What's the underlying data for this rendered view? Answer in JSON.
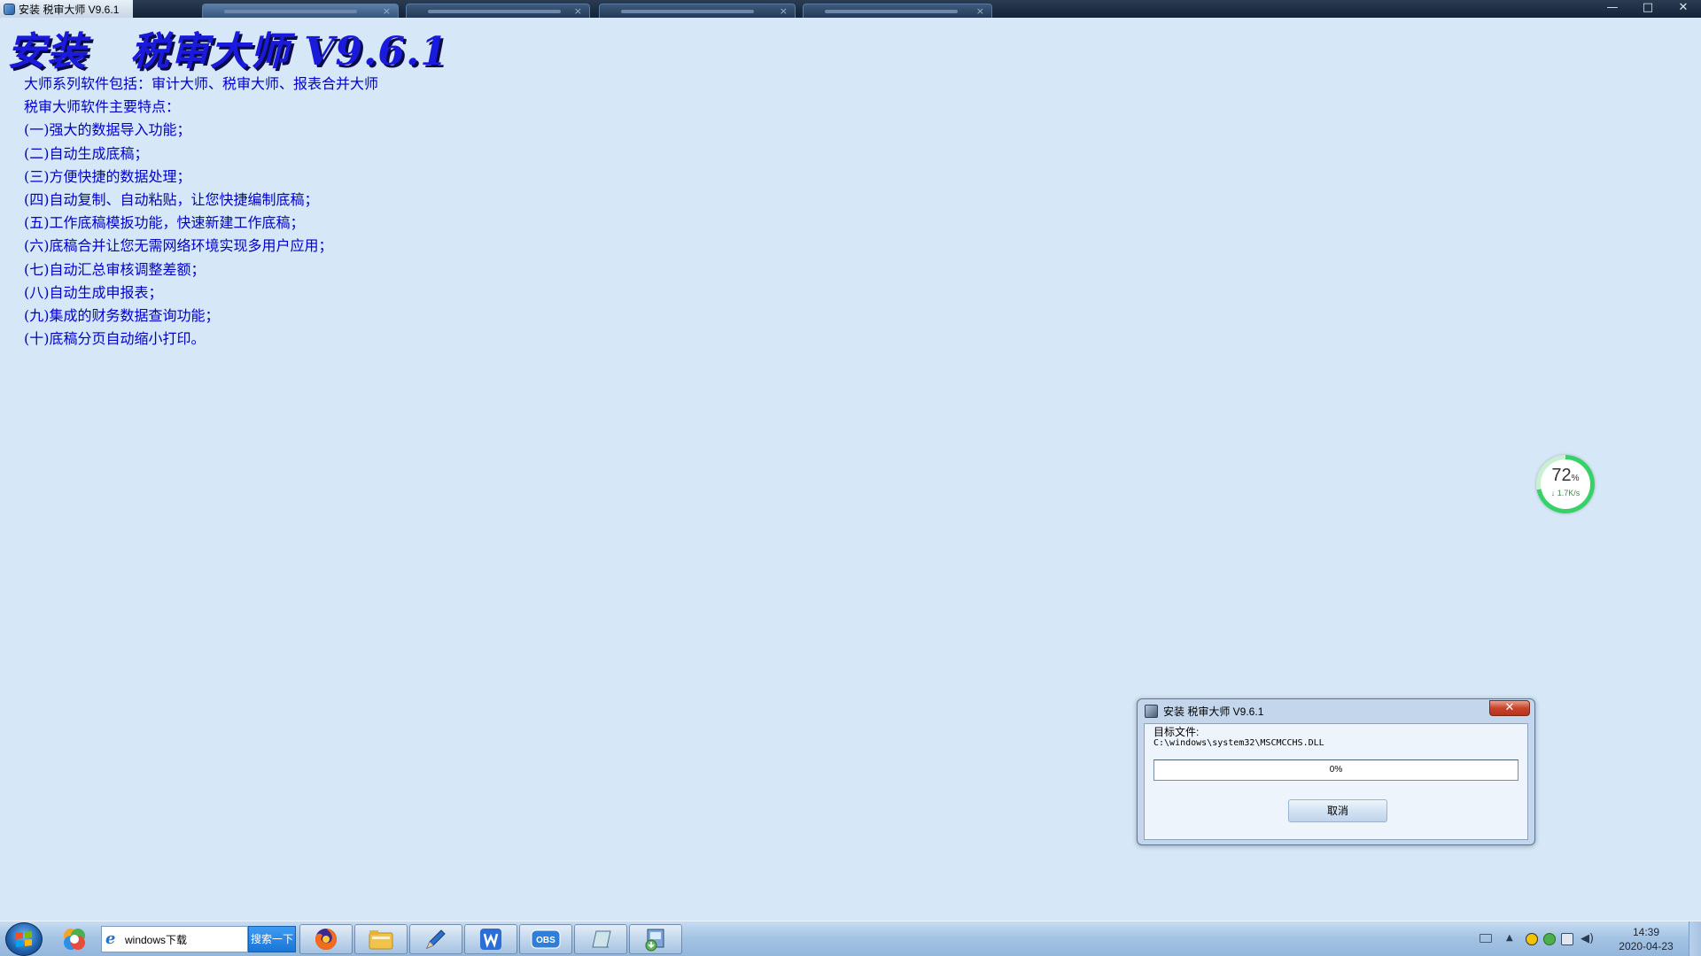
{
  "window": {
    "title": "安装 税审大师 V9.6.1",
    "minimize": "—",
    "maximize": "□",
    "close": "✕"
  },
  "header": {
    "title": "安装   税审大师 V9.6.1"
  },
  "intro": {
    "lines": [
      "大师系列软件包括：审计大师、税审大师、报表合并大师",
      "税审大师软件主要特点：",
      "(一)强大的数据导入功能；",
      "(二)自动生成底稿；",
      "(三)方便快捷的数据处理；",
      "(四)自动复制、自动粘贴，让您快捷编制底稿；",
      "(五)工作底稿模扳功能，快速新建工作底稿；",
      "(六)底稿合并让您无需网络环境实现多用户应用；",
      "(七)自动汇总审核调整差额；",
      "(八)自动生成申报表；",
      "(九)集成的财务数据查询功能；",
      "(十)底稿分页自动缩小打印。"
    ]
  },
  "speed_widget": {
    "percent": "72",
    "percent_unit": "%",
    "rate": "↓ 1.7K/s",
    "level": 0.72
  },
  "dialog": {
    "title": "安装  税审大师 V9.6.1",
    "close_label": "✕",
    "target_label": "目标文件:",
    "target_path": "C:\\windows\\system32\\MSCMCCHS.DLL",
    "progress_text": "0%",
    "progress_value": 0,
    "cancel_label": "取消"
  },
  "taskbar": {
    "search_value": "windows下载",
    "search_button": "搜索一下",
    "clock_time": "14:39",
    "clock_date": "2020-04-23",
    "pinned_icons": [
      "browser-icon",
      "firefox-icon",
      "file-explorer-icon",
      "pen-tool-icon",
      "wps-icon",
      "obs-icon",
      "notepad-icon",
      "installer-icon"
    ]
  },
  "colors": {
    "background": "#d6e7f7",
    "title_blue": "#1a1adc",
    "text_blue": "#0000cc",
    "widget_green": "#37d267"
  }
}
